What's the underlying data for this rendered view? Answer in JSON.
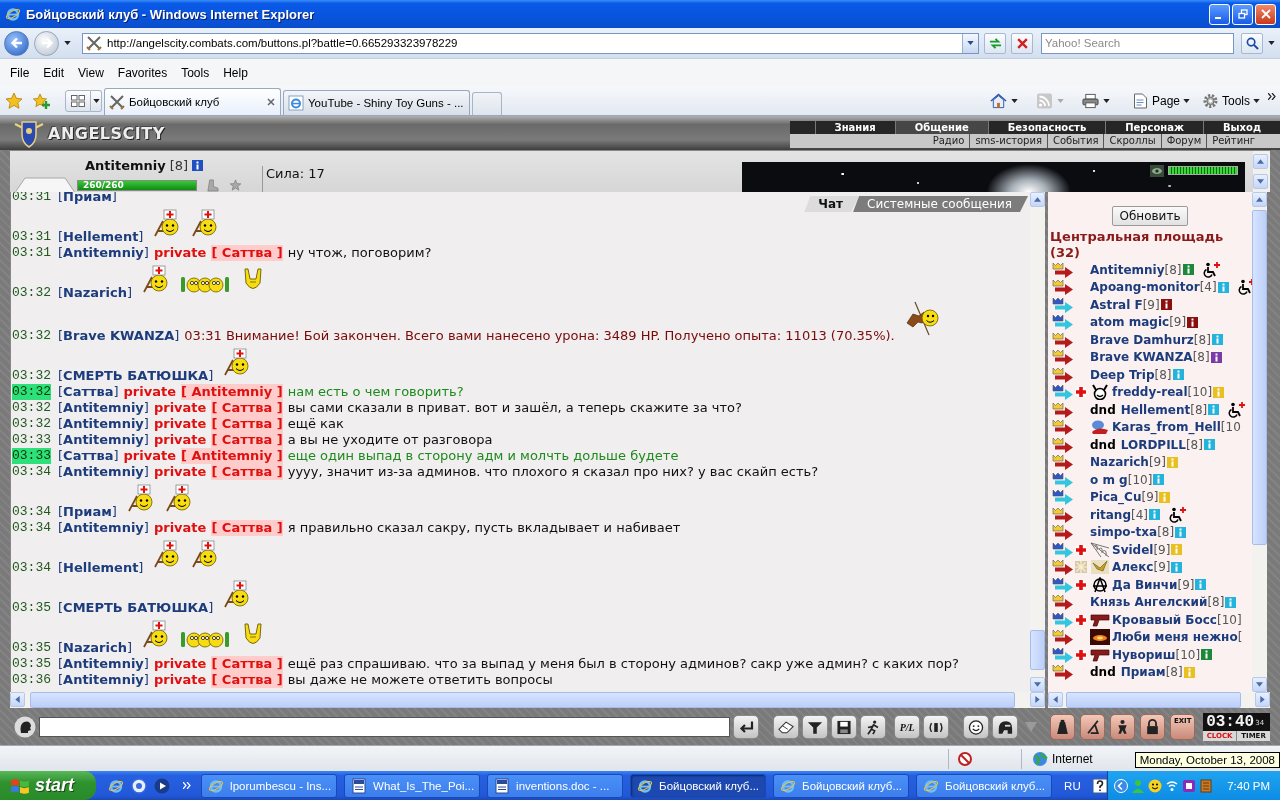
{
  "window": {
    "title": "Бойцовский клуб - Windows Internet Explorer"
  },
  "address_bar": {
    "url": "http://angelscity.combats.com/buttons.pl?battle=0.665293323978229"
  },
  "search": {
    "placeholder": "Yahoo! Search"
  },
  "menu": [
    "File",
    "Edit",
    "View",
    "Favorites",
    "Tools",
    "Help"
  ],
  "tabs": [
    {
      "label": "Бойцовский клуб",
      "selected": true,
      "kind": "custom"
    },
    {
      "label": "YouTube - Shiny Toy Guns - ...",
      "selected": false,
      "kind": "default"
    }
  ],
  "command_bar": [
    "Page",
    "Tools"
  ],
  "game": {
    "logo": "ANGELSCITY",
    "nav": [
      {
        "label": "Знания",
        "selected": false
      },
      {
        "label": "Общение",
        "selected": true
      },
      {
        "label": "Безопасность",
        "selected": false
      },
      {
        "label": "Персонаж",
        "selected": false
      },
      {
        "label": "Выход",
        "selected": false
      }
    ],
    "subnav": [
      "Радио",
      "sms-история",
      "События",
      "Скроллы",
      "Форум",
      "Рейтинг"
    ],
    "character": {
      "name": "Antitemniy",
      "rank": "[8]",
      "health": {
        "reading": "260/260",
        "level": 1
      },
      "stat": "Сила: 17"
    },
    "chat_tabs": [
      {
        "label": "Чат",
        "selected": true
      },
      {
        "label": "Системные сообщения",
        "selected": false
      }
    ],
    "messages": [
      {
        "time": "03:31",
        "highlight": false,
        "sender": "[**Приам**]",
        "kind": "emote"
      },
      {
        "time": "03:31",
        "highlight": false,
        "sender": "[**Hellement**]",
        "kind": "emote",
        "smileys": [
          {
            "kind": "medic"
          },
          {
            "kind": "medic"
          }
        ]
      },
      {
        "time": "03:31",
        "highlight": false,
        "sender": "[**Antitemniy**]",
        "kind": "outgoing",
        "private_label": "private",
        "recipient": "[ Саттва ]",
        "text": "ну чтож, поговорим?"
      },
      {
        "time": "03:32",
        "highlight": false,
        "sender": "[**Nazarich**]",
        "kind": "emote",
        "smileys": [
          {
            "kind": "medic"
          },
          {
            "kind": "trio"
          },
          {
            "kind": "horns"
          }
        ]
      },
      {
        "time": "03:32",
        "highlight": false,
        "sender": "[**Brave KWANZA**]",
        "kind": "system",
        "text": "03:31 Внимание! Бой закончен. Всего вами нанесено урона: 3489 HP. Получено опыта: 11013 (70.35%).",
        "smileys": [
          {
            "kind": "rider"
          }
        ]
      },
      {
        "time": "03:32",
        "highlight": false,
        "sender": "[**СМЕРТЬ БАТЮШКА**]",
        "kind": "emote",
        "smileys": [
          {
            "kind": "medic"
          }
        ]
      },
      {
        "time": "03:32",
        "highlight": true,
        "sender": "[**Саттва**]",
        "kind": "incoming",
        "private_label": "private",
        "recipient": "[ Antitemniy ]",
        "text": "нам есть о чем говорить?"
      },
      {
        "time": "03:32",
        "highlight": false,
        "sender": "[**Antitemniy**]",
        "kind": "outgoing",
        "private_label": "private",
        "recipient": "[ Саттва ]",
        "text": "вы сами сказали в приват. вот и зашёл, а теперь скажите за что?"
      },
      {
        "time": "03:32",
        "highlight": false,
        "sender": "[**Antitemniy**]",
        "kind": "outgoing",
        "private_label": "private",
        "recipient": "[ Саттва ]",
        "text": "ещё как"
      },
      {
        "time": "03:33",
        "highlight": false,
        "sender": "[**Antitemniy**]",
        "kind": "outgoing",
        "private_label": "private",
        "recipient": "[ Саттва ]",
        "text": "а вы не уходите от разговора"
      },
      {
        "time": "03:33",
        "highlight": true,
        "sender": "[**Саттва**]",
        "kind": "incoming",
        "private_label": "private",
        "recipient": "[ Antitemniy ]",
        "text": "еще один выпад в сторону адм и молчть дольше будете"
      },
      {
        "time": "03:34",
        "highlight": false,
        "sender": "[**Antitemniy**]",
        "kind": "outgoing",
        "private_label": "private",
        "recipient": "[ Саттва ]",
        "text": "уууу, значит из-за админов. что плохого я сказал про них? у вас скайп есть?"
      },
      {
        "time": "03:34",
        "highlight": false,
        "sender": "[**Приам**]",
        "kind": "emote",
        "smileys": [
          {
            "kind": "medic"
          },
          {
            "kind": "medic"
          }
        ]
      },
      {
        "time": "03:34",
        "highlight": false,
        "sender": "[**Antitemniy**]",
        "kind": "outgoing",
        "private_label": "private",
        "recipient": "[ Саттва ]",
        "text": "я правильно сказал сакру, пусть вкладывает и набивает"
      },
      {
        "time": "03:34",
        "highlight": false,
        "sender": "[**Hellement**]",
        "kind": "emote",
        "smileys": [
          {
            "kind": "medic"
          },
          {
            "kind": "medic"
          }
        ]
      },
      {
        "time": "03:35",
        "highlight": false,
        "sender": "[**СМЕРТЬ БАТЮШКА**]",
        "kind": "emote",
        "smileys": [
          {
            "kind": "medic"
          }
        ]
      },
      {
        "time": "03:35",
        "highlight": false,
        "sender": "[**Nazarich**]",
        "kind": "emote",
        "smileys": [
          {
            "kind": "medic"
          },
          {
            "kind": "trio"
          },
          {
            "kind": "horns"
          }
        ]
      },
      {
        "time": "03:35",
        "highlight": false,
        "sender": "[**Antitemniy**]",
        "kind": "outgoing",
        "private_label": "private",
        "recipient": "[ Саттва ]",
        "text": "ещё раз спрашиваю. что за выпад у меня был в сторону админов? сакр уже админ? с каких пор?"
      },
      {
        "time": "03:36",
        "highlight": false,
        "sender": "[**Antitemniy**]",
        "kind": "outgoing",
        "private_label": "private",
        "recipient": "[ Саттва ]",
        "text": "вы даже не можете ответить вопросы"
      }
    ],
    "room": {
      "refresh_button": "Обновить",
      "title": "Центральная площадь (32)",
      "users": [
        {
          "kind": "gold",
          "name": "Antitemniy",
          "rank": "[8]",
          "color": "#1a8a3a",
          "injured": true
        },
        {
          "kind": "gold",
          "name": "Apoang-monitor",
          "rank": "[4]",
          "color": "#22b4dc",
          "injured": true
        },
        {
          "kind": "blue",
          "name": "Astral F",
          "rank": "[9]",
          "color": "#8a1010",
          "injured": false
        },
        {
          "kind": "blue",
          "name": "atom magic",
          "rank": "[9]",
          "color": "#8a1010",
          "injured": false
        },
        {
          "kind": "gold",
          "name": "Brave Damhurz",
          "rank": "[8]",
          "color": "#22b4dc",
          "injured": false
        },
        {
          "kind": "gold",
          "name": "Brave KWANZA",
          "rank": "[8]",
          "color": "#7a3aa8",
          "injured": false
        },
        {
          "kind": "gold",
          "name": "Deep Trip",
          "rank": "[8]",
          "color": "#22b4dc",
          "injured": false
        },
        {
          "kind": "blue",
          "mark": {
            "kind": "cross"
          },
          "emblem": {
            "kind": "mask"
          },
          "name": "freddy-real",
          "rank": "[10]",
          "color": "#e8c020",
          "injured": false
        },
        {
          "kind": "gold",
          "prefix": "dnd",
          "name": "Hellement",
          "rank": "[8]",
          "color": "#22b4dc",
          "injured": true
        },
        {
          "kind": "gold",
          "emblem": {
            "kind": "creature"
          },
          "name": "Karas_from_Hell",
          "rank": "[10",
          "injured": false
        },
        {
          "kind": "gold",
          "prefix": "dnd",
          "name": "LORDPILL",
          "rank": "[8]",
          "color": "#22b4dc",
          "injured": false
        },
        {
          "kind": "gold",
          "name": "Nazarich",
          "rank": "[9]",
          "color": "#e8c020",
          "injured": false
        },
        {
          "kind": "blue",
          "name": "o m g",
          "rank": "[10]",
          "color": "#22b4dc",
          "injured": false
        },
        {
          "kind": "blue",
          "name": "Pica_Cu",
          "rank": "[9]",
          "color": "#e8c020",
          "injured": false
        },
        {
          "kind": "gold",
          "name": "ritang",
          "rank": "[4]",
          "color": "#22b4dc",
          "injured": true
        },
        {
          "kind": "gold",
          "name": "simpo-txa",
          "rank": "[8]",
          "color": "#22b4dc",
          "injured": false
        },
        {
          "kind": "blue",
          "mark": {
            "kind": "cross"
          },
          "emblem": {
            "kind": "web"
          },
          "name": "Svidel",
          "rank": "[9]",
          "color": "#e8c020",
          "injured": false
        },
        {
          "kind": "gold",
          "mark": {
            "kind": "spark"
          },
          "emblem": {
            "kind": "bird"
          },
          "name": "Алекс",
          "rank": "[9]",
          "color": "#22b4dc",
          "injured": false
        },
        {
          "kind": "blue",
          "mark": {
            "kind": "cross"
          },
          "emblem": {
            "kind": "anarchy"
          },
          "name": "Да Винчи",
          "rank": "[9]",
          "color": "#22b4dc",
          "injured": false
        },
        {
          "kind": "gold",
          "name": "Князь Ангелский",
          "rank": "[8]",
          "color": "#22b4dc",
          "injured": false
        },
        {
          "kind": "blue",
          "mark": {
            "kind": "cross"
          },
          "emblem": {
            "kind": "pistol"
          },
          "name": "Кровавый Босс",
          "rank": "[10]",
          "injured": false
        },
        {
          "kind": "gold",
          "emblem": {
            "kind": "flame"
          },
          "name": "Люби меня нежно",
          "rank": "[",
          "injured": false
        },
        {
          "kind": "blue",
          "mark": {
            "kind": "cross"
          },
          "emblem": {
            "kind": "pistol"
          },
          "name": "Нувориш",
          "rank": "[10]",
          "color": "#1a8a3a",
          "injured": false
        },
        {
          "kind": "gold",
          "prefix": "dnd",
          "name": "Приам",
          "rank": "[8]",
          "color": "#e8c020",
          "injured": false
        }
      ]
    },
    "toolbar": {
      "pl_button": "P/L",
      "exit_button": "EXIT"
    },
    "clock": {
      "time": "03:40",
      "seconds": "34",
      "clock_label": "CLOCK",
      "timer_label": "TIMER"
    }
  },
  "status_bar": {
    "zone": "Internet",
    "tooltip": "Monday, October 13, 2008"
  },
  "taskbar": {
    "start": "start",
    "items": [
      {
        "label": "lporumbescu - Ins...",
        "selected": false,
        "kind": "browser"
      },
      {
        "label": "What_Is_The_Poi...",
        "selected": false,
        "kind": "document"
      },
      {
        "label": "inventions.doc - ...",
        "selected": false,
        "kind": "document"
      },
      {
        "label": "Бойцовский клуб...",
        "selected": true,
        "kind": "browser"
      },
      {
        "label": "Бойцовский клуб...",
        "selected": false,
        "kind": "browser"
      },
      {
        "label": "Бойцовский клуб...",
        "selected": false,
        "kind": "browser"
      }
    ],
    "language": "RU",
    "clock": "7:40 PM"
  }
}
